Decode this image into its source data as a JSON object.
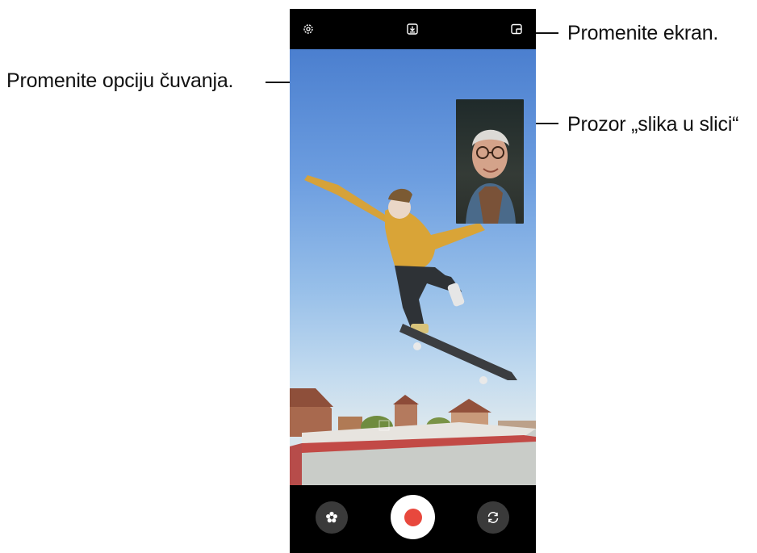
{
  "callouts": {
    "save_option": "Promenite opciju čuvanja.",
    "change_screen": "Promenite ekran.",
    "pip_window": "Prozor „slika u slici“"
  },
  "camera": {
    "lens_label": "‹",
    "icons": {
      "settings": "gear-icon",
      "save_option": "download-icon",
      "change_screen": "split-screen-icon",
      "effects": "flower-icon",
      "record": "record-icon",
      "switch_camera": "switch-camera-icon"
    },
    "colors": {
      "record": "#e8483d",
      "bar": "#000000",
      "sky": "#6d9ee0"
    }
  }
}
